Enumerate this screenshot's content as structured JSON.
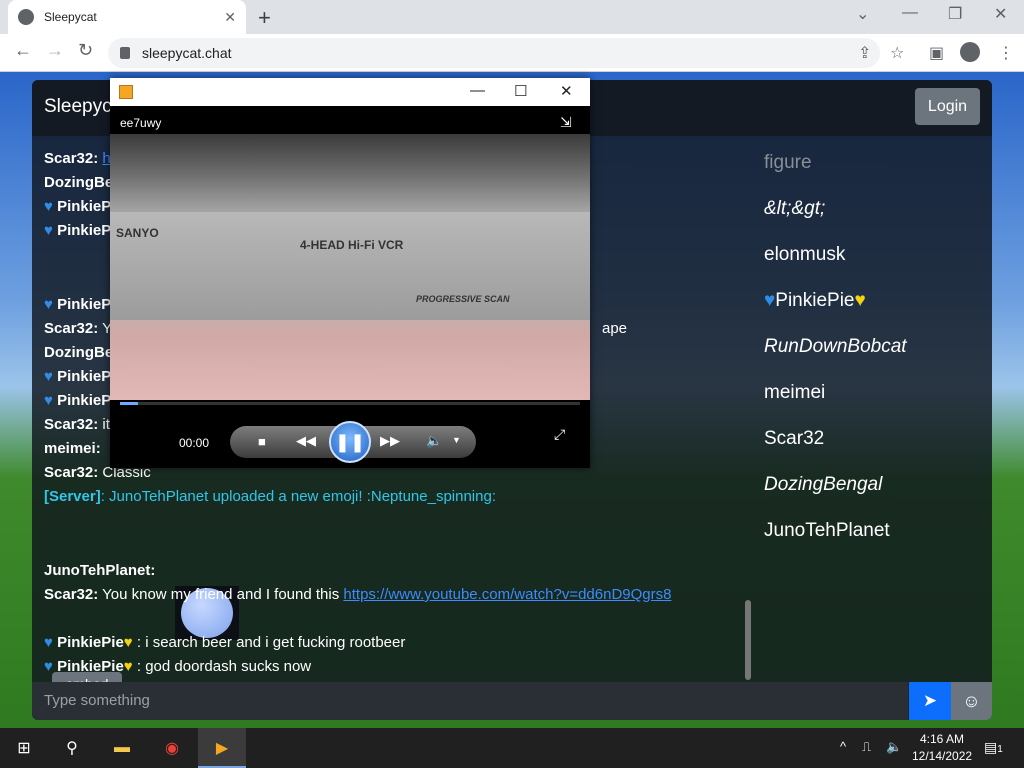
{
  "browser": {
    "tab_title": "Sleepycat",
    "tab_close": "✕",
    "new_tab": "+",
    "url": "sleepycat.chat",
    "window_controls": [
      "⌄",
      "—",
      "❐",
      "✕"
    ]
  },
  "app": {
    "title": "Sleepycat",
    "login_label": "Login",
    "input_placeholder": "Type something",
    "embed_label": "embed"
  },
  "messages": [
    {
      "user": "Scar32:",
      "text": "h",
      "link": true
    },
    {
      "user": "DozingBe",
      "text": ""
    },
    {
      "user": "PinkiePie",
      "text": "",
      "heart": true
    },
    {
      "user": "PinkiePie",
      "text": "",
      "heart": true
    },
    {
      "user": "PinkiePie",
      "text": "",
      "heart": true
    },
    {
      "user": "Scar32:",
      "text": "Y"
    },
    {
      "user": "DozingBe",
      "text": ""
    },
    {
      "user": "PinkiePie",
      "text": "",
      "heart": true
    },
    {
      "user": "PinkiePie",
      "text": "",
      "heart": true
    },
    {
      "user": "Scar32:",
      "text": "it"
    },
    {
      "user": "meimei:",
      "text": ""
    },
    {
      "user": "Scar32:",
      "text": "Classic"
    },
    {
      "user": "[Server]",
      "text": ": JunoTehPlanet uploaded a new emoji! :Neptune_spinning:",
      "server": true
    },
    {
      "user": "JunoTehPlanet:",
      "text": ""
    },
    {
      "user": "Scar32:",
      "text": "You know my friend and I found this ",
      "link_text": "https://www.youtube.com/watch?v=dd6nD9Qgrs8"
    },
    {
      "user": "PinkiePie",
      "text": " : i search beer and i get fucking rootbeer",
      "heart": true,
      "yheart": true
    },
    {
      "user": "PinkiePie",
      "text": " : god doordash sucks now",
      "heart": true,
      "yheart": true
    }
  ],
  "partial_text": {
    "tape": "ape"
  },
  "users": [
    {
      "name": "figure",
      "style": "muted"
    },
    {
      "name": "&lt;&gt;",
      "style": "italic"
    },
    {
      "name": "elonmusk",
      "style": "normal"
    },
    {
      "name": "PinkiePie",
      "style": "normal",
      "hearts": true
    },
    {
      "name": "RunDownBobcat",
      "style": "italic"
    },
    {
      "name": "meimei",
      "style": "normal"
    },
    {
      "name": "Scar32",
      "style": "normal"
    },
    {
      "name": "DozingBengal",
      "style": "italic"
    },
    {
      "name": "JunoTehPlanet",
      "style": "normal"
    }
  ],
  "player": {
    "name": "ee7uwy",
    "time": "00:00",
    "progress": 0.04,
    "vcr_brand": "SANYO",
    "vcr_label": "4-HEAD Hi-Fi VCR",
    "vcr_scan": "PROGRESSIVE SCAN"
  },
  "taskbar": {
    "time": "4:16 AM",
    "date": "12/14/2022",
    "notification_count": "1"
  },
  "colors": {
    "accent": "#0d6efd",
    "server": "#31c6e8",
    "link": "#3d8bfd"
  }
}
